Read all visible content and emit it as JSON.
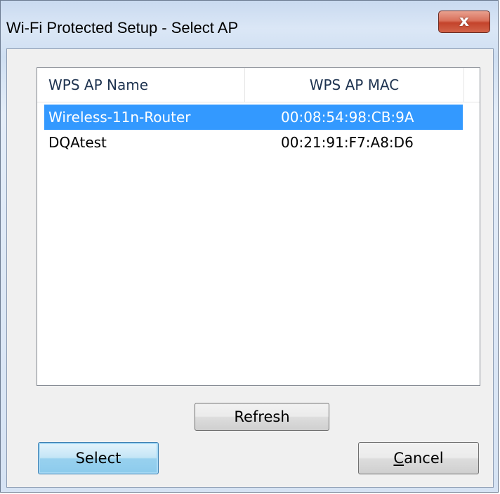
{
  "window": {
    "title": "Wi-Fi Protected Setup - Select AP",
    "close_glyph": "x"
  },
  "list": {
    "columns": [
      "WPS AP Name",
      "WPS AP MAC"
    ],
    "rows": [
      {
        "name": "Wireless-11n-Router",
        "mac": "00:08:54:98:CB:9A",
        "selected": true
      },
      {
        "name": "DQAtest",
        "mac": "00:21:91:F7:A8:D6",
        "selected": false
      }
    ]
  },
  "buttons": {
    "refresh": "Refresh",
    "select": "Select",
    "cancel_accel": "C",
    "cancel_rest": "ancel"
  },
  "colors": {
    "selection": "#3399ff",
    "close_button": "#c4432b",
    "default_button": "#98d1ef"
  },
  "icons": {
    "close": "close-icon"
  }
}
